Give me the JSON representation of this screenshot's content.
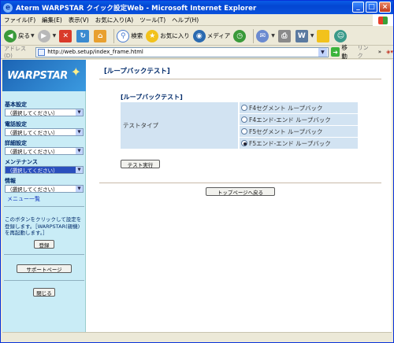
{
  "window": {
    "title": "Aterm WARPSTAR クイック設定Web - Microsoft Internet Explorer",
    "minimize": "_",
    "maximize": "□",
    "close": "×"
  },
  "menubar": [
    "ファイル(F)",
    "編集(E)",
    "表示(V)",
    "お気に入り(A)",
    "ツール(T)",
    "ヘルプ(H)"
  ],
  "toolbar": {
    "back": "戻る",
    "search": "検索",
    "favorites": "お気に入り",
    "media": "メディア"
  },
  "address": {
    "label": "アドレス(D)",
    "url": "http://web.setup/index_frame.html",
    "go": "移動",
    "links": "リンク"
  },
  "sidebar": {
    "logo": "WARPSTAR",
    "sections": [
      {
        "label": "基本設定",
        "value": "（選択してください）"
      },
      {
        "label": "電話設定",
        "value": "（選択してください）"
      },
      {
        "label": "詳細設定",
        "value": "（選択してください）"
      },
      {
        "label": "メンテナンス",
        "value": "（選択してください）"
      },
      {
        "label": "情報",
        "value": "（選択してください）"
      }
    ],
    "menu_list": "メニュー一覧",
    "note": "このボタンをクリックして設定を登録します。［WARPSTAR(親機)を再起動します。］",
    "register_button": "登録",
    "support_button": "サポートページ",
    "close_button": "閉じる"
  },
  "main": {
    "title": "[ループバックテスト]",
    "subtitle": "[ループバックテスト]",
    "test_type_label": "テストタイプ",
    "options": [
      {
        "label": "F4セグメント ループバック",
        "selected": false
      },
      {
        "label": "F4エンド-エンド ループバック",
        "selected": false
      },
      {
        "label": "F5セグメント ループバック",
        "selected": false
      },
      {
        "label": "F5エンド-エンド ループバック",
        "selected": true
      }
    ],
    "run_button": "テスト実行",
    "top_button": "トップページへ戻る"
  }
}
